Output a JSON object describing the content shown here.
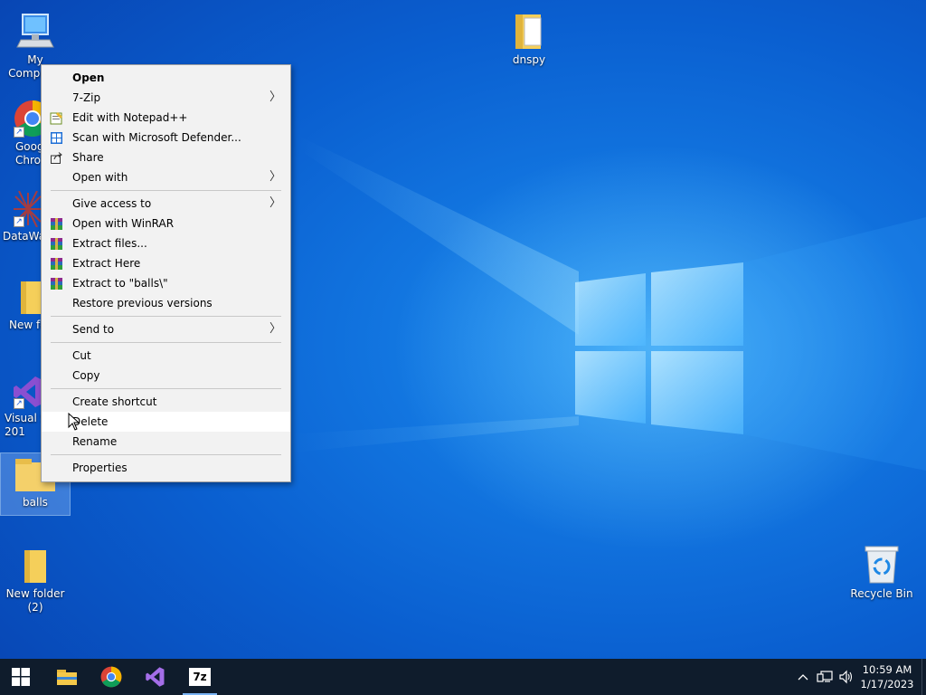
{
  "desktop": {
    "icons": [
      {
        "label": "My Computer",
        "icon": "computer-icon"
      },
      {
        "label": "Goog Chro",
        "icon": "chrome-icon"
      },
      {
        "label": "DataWa",
        "icon": "datawarrior-icon"
      },
      {
        "label": "New fo",
        "icon": "folder-icon"
      },
      {
        "label": "Visual S 201",
        "icon": "visual-studio-icon"
      },
      {
        "label": "balls",
        "icon": "archive-folder-icon"
      },
      {
        "label": "New folder (2)",
        "icon": "folder-icon"
      },
      {
        "label": "dnspy",
        "icon": "folder-icon"
      },
      {
        "label": "Recycle Bin",
        "icon": "recycle-bin-icon"
      }
    ]
  },
  "context_menu": {
    "items": [
      {
        "label": "Open"
      },
      {
        "label": "7-Zip"
      },
      {
        "label": "Edit with Notepad++"
      },
      {
        "label": "Scan with Microsoft Defender..."
      },
      {
        "label": "Share"
      },
      {
        "label": "Open with"
      },
      {
        "label": "Give access to"
      },
      {
        "label": "Open with WinRAR"
      },
      {
        "label": "Extract files..."
      },
      {
        "label": "Extract Here"
      },
      {
        "label": "Extract to \"balls\\\""
      },
      {
        "label": "Restore previous versions"
      },
      {
        "label": "Send to"
      },
      {
        "label": "Cut"
      },
      {
        "label": "Copy"
      },
      {
        "label": "Create shortcut"
      },
      {
        "label": "Delete"
      },
      {
        "label": "Rename"
      },
      {
        "label": "Properties"
      }
    ]
  },
  "taskbar": {
    "pinned": [
      "start-button",
      "file-explorer",
      "chrome",
      "visual-studio",
      "7-zip"
    ],
    "sevenzip_label": "7z",
    "clock": {
      "time": "10:59 AM",
      "date": "1/17/2023"
    }
  },
  "colors": {
    "wallpaper": "#0b63d3",
    "menu_bg": "#f2f2f2",
    "taskbar": "#0f1c2c"
  }
}
